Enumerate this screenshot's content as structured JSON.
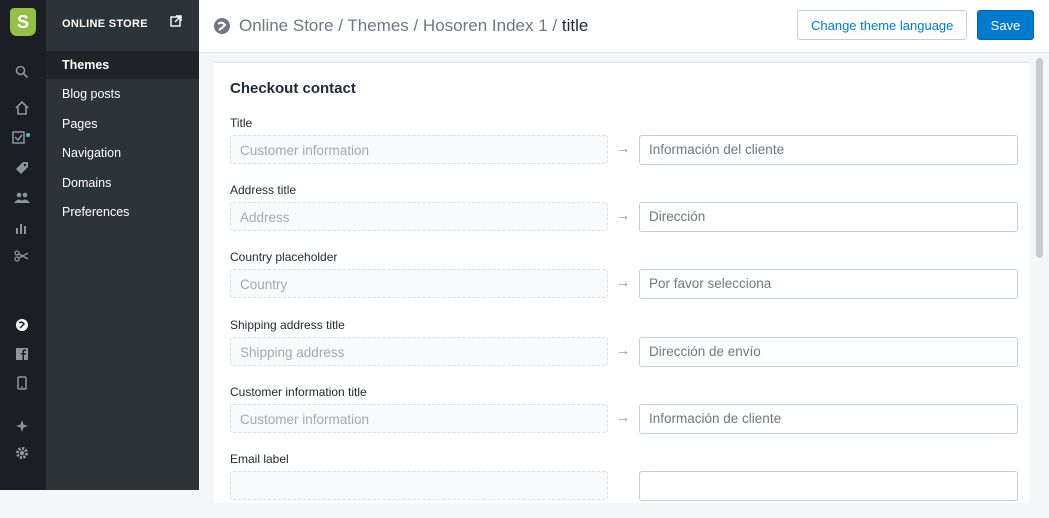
{
  "nav": {
    "header": "ONLINE STORE",
    "items": [
      {
        "label": "Themes",
        "active": true
      },
      {
        "label": "Blog posts"
      },
      {
        "label": "Pages"
      },
      {
        "label": "Navigation"
      },
      {
        "label": "Domains"
      },
      {
        "label": "Preferences"
      }
    ]
  },
  "header": {
    "breadcrumb": "Online Store / Themes / Hosoren Index 1 / ",
    "current": "title",
    "change_language_label": "Change theme language",
    "save_label": "Save"
  },
  "section": {
    "title": "Checkout contact",
    "fields": [
      {
        "label": "Title",
        "source": "Customer information",
        "translation": "Información del cliente"
      },
      {
        "label": "Address title",
        "source": "Address",
        "translation": "Dirección"
      },
      {
        "label": "Country placeholder",
        "source": "Country",
        "translation": "Por favor selecciona"
      },
      {
        "label": "Shipping address title",
        "source": "Shipping address",
        "translation": "Dirección de envío"
      },
      {
        "label": "Customer information title",
        "source": "Customer information",
        "translation": "Información de cliente"
      },
      {
        "label": "Email label",
        "source": "",
        "translation": ""
      }
    ]
  },
  "colors": {
    "accent": "#007ace",
    "sidebar": "#2e3338",
    "iconbar": "#1b1f24",
    "brand": "#95bf47"
  }
}
